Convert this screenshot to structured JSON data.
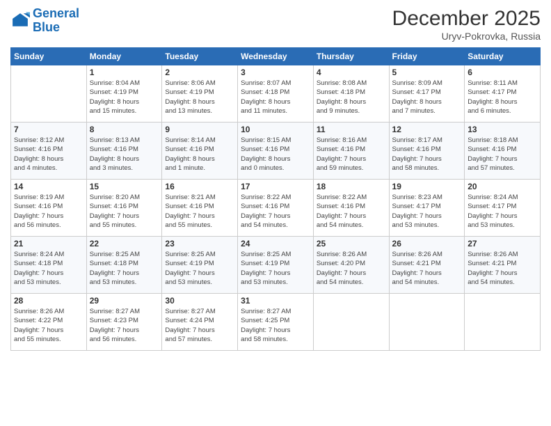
{
  "logo": {
    "line1": "General",
    "line2": "Blue"
  },
  "title": "December 2025",
  "location": "Uryv-Pokrovka, Russia",
  "headers": [
    "Sunday",
    "Monday",
    "Tuesday",
    "Wednesday",
    "Thursday",
    "Friday",
    "Saturday"
  ],
  "weeks": [
    [
      {
        "day": "",
        "info": ""
      },
      {
        "day": "1",
        "info": "Sunrise: 8:04 AM\nSunset: 4:19 PM\nDaylight: 8 hours\nand 15 minutes."
      },
      {
        "day": "2",
        "info": "Sunrise: 8:06 AM\nSunset: 4:19 PM\nDaylight: 8 hours\nand 13 minutes."
      },
      {
        "day": "3",
        "info": "Sunrise: 8:07 AM\nSunset: 4:18 PM\nDaylight: 8 hours\nand 11 minutes."
      },
      {
        "day": "4",
        "info": "Sunrise: 8:08 AM\nSunset: 4:18 PM\nDaylight: 8 hours\nand 9 minutes."
      },
      {
        "day": "5",
        "info": "Sunrise: 8:09 AM\nSunset: 4:17 PM\nDaylight: 8 hours\nand 7 minutes."
      },
      {
        "day": "6",
        "info": "Sunrise: 8:11 AM\nSunset: 4:17 PM\nDaylight: 8 hours\nand 6 minutes."
      }
    ],
    [
      {
        "day": "7",
        "info": "Sunrise: 8:12 AM\nSunset: 4:16 PM\nDaylight: 8 hours\nand 4 minutes."
      },
      {
        "day": "8",
        "info": "Sunrise: 8:13 AM\nSunset: 4:16 PM\nDaylight: 8 hours\nand 3 minutes."
      },
      {
        "day": "9",
        "info": "Sunrise: 8:14 AM\nSunset: 4:16 PM\nDaylight: 8 hours\nand 1 minute."
      },
      {
        "day": "10",
        "info": "Sunrise: 8:15 AM\nSunset: 4:16 PM\nDaylight: 8 hours\nand 0 minutes."
      },
      {
        "day": "11",
        "info": "Sunrise: 8:16 AM\nSunset: 4:16 PM\nDaylight: 7 hours\nand 59 minutes."
      },
      {
        "day": "12",
        "info": "Sunrise: 8:17 AM\nSunset: 4:16 PM\nDaylight: 7 hours\nand 58 minutes."
      },
      {
        "day": "13",
        "info": "Sunrise: 8:18 AM\nSunset: 4:16 PM\nDaylight: 7 hours\nand 57 minutes."
      }
    ],
    [
      {
        "day": "14",
        "info": "Sunrise: 8:19 AM\nSunset: 4:16 PM\nDaylight: 7 hours\nand 56 minutes."
      },
      {
        "day": "15",
        "info": "Sunrise: 8:20 AM\nSunset: 4:16 PM\nDaylight: 7 hours\nand 55 minutes."
      },
      {
        "day": "16",
        "info": "Sunrise: 8:21 AM\nSunset: 4:16 PM\nDaylight: 7 hours\nand 55 minutes."
      },
      {
        "day": "17",
        "info": "Sunrise: 8:22 AM\nSunset: 4:16 PM\nDaylight: 7 hours\nand 54 minutes."
      },
      {
        "day": "18",
        "info": "Sunrise: 8:22 AM\nSunset: 4:16 PM\nDaylight: 7 hours\nand 54 minutes."
      },
      {
        "day": "19",
        "info": "Sunrise: 8:23 AM\nSunset: 4:17 PM\nDaylight: 7 hours\nand 53 minutes."
      },
      {
        "day": "20",
        "info": "Sunrise: 8:24 AM\nSunset: 4:17 PM\nDaylight: 7 hours\nand 53 minutes."
      }
    ],
    [
      {
        "day": "21",
        "info": "Sunrise: 8:24 AM\nSunset: 4:18 PM\nDaylight: 7 hours\nand 53 minutes."
      },
      {
        "day": "22",
        "info": "Sunrise: 8:25 AM\nSunset: 4:18 PM\nDaylight: 7 hours\nand 53 minutes."
      },
      {
        "day": "23",
        "info": "Sunrise: 8:25 AM\nSunset: 4:19 PM\nDaylight: 7 hours\nand 53 minutes."
      },
      {
        "day": "24",
        "info": "Sunrise: 8:25 AM\nSunset: 4:19 PM\nDaylight: 7 hours\nand 53 minutes."
      },
      {
        "day": "25",
        "info": "Sunrise: 8:26 AM\nSunset: 4:20 PM\nDaylight: 7 hours\nand 54 minutes."
      },
      {
        "day": "26",
        "info": "Sunrise: 8:26 AM\nSunset: 4:21 PM\nDaylight: 7 hours\nand 54 minutes."
      },
      {
        "day": "27",
        "info": "Sunrise: 8:26 AM\nSunset: 4:21 PM\nDaylight: 7 hours\nand 54 minutes."
      }
    ],
    [
      {
        "day": "28",
        "info": "Sunrise: 8:26 AM\nSunset: 4:22 PM\nDaylight: 7 hours\nand 55 minutes."
      },
      {
        "day": "29",
        "info": "Sunrise: 8:27 AM\nSunset: 4:23 PM\nDaylight: 7 hours\nand 56 minutes."
      },
      {
        "day": "30",
        "info": "Sunrise: 8:27 AM\nSunset: 4:24 PM\nDaylight: 7 hours\nand 57 minutes."
      },
      {
        "day": "31",
        "info": "Sunrise: 8:27 AM\nSunset: 4:25 PM\nDaylight: 7 hours\nand 58 minutes."
      },
      {
        "day": "",
        "info": ""
      },
      {
        "day": "",
        "info": ""
      },
      {
        "day": "",
        "info": ""
      }
    ]
  ]
}
